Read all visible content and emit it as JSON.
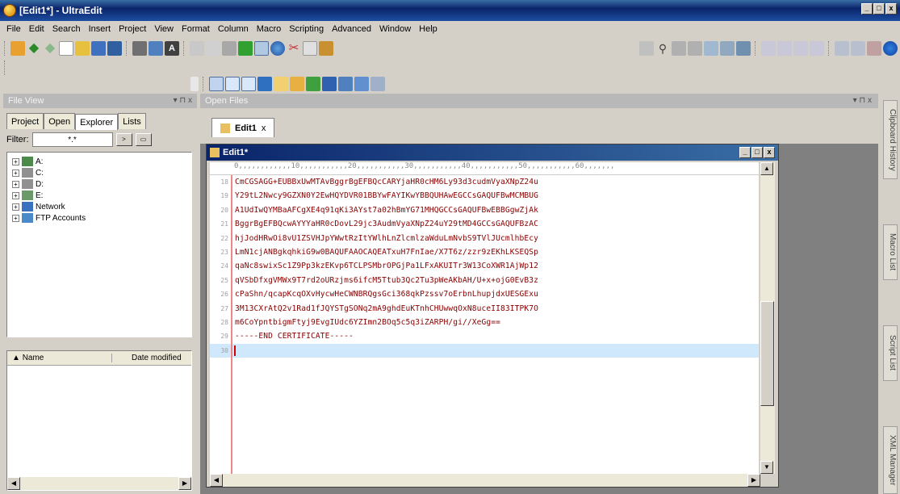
{
  "window": {
    "title": "[Edit1*] - UltraEdit",
    "min": "_",
    "max": "□",
    "close": "x"
  },
  "menu": [
    "File",
    "Edit",
    "Search",
    "Insert",
    "Project",
    "View",
    "Format",
    "Column",
    "Macro",
    "Scripting",
    "Advanced",
    "Window",
    "Help"
  ],
  "file_view": {
    "header": "File View",
    "tabs": [
      "Project",
      "Open",
      "Explorer",
      "Lists"
    ],
    "active_tab": "Explorer",
    "filter_label": "Filter:",
    "filter_value": "*.*",
    "tree": [
      "A:",
      "C:",
      "D:",
      "E:",
      "Network",
      "FTP Accounts"
    ],
    "columns": [
      "Name",
      "Date modified"
    ]
  },
  "open_files": {
    "header": "Open Files",
    "tab_label": "Edit1"
  },
  "editor": {
    "title": "Edit1*",
    "ruler": "0,,,,,,,,,,,,10,,,,,,,,,,,20,,,,,,,,,,,30,,,,,,,,,,,40,,,,,,,,,,,50,,,,,,,,,,,60,,,,,,,",
    "line_numbers": [
      "18",
      "19",
      "20",
      "21",
      "22",
      "23",
      "24",
      "25",
      "26",
      "27",
      "28",
      "29",
      "30"
    ],
    "lines": [
      "CmCGSAGG+EUBBxUwMTAvBggrBgEFBQcCARYjaHR0cHM6Ly93d3cudmVyaXNpZ24u",
      "Y29tL2Nwcy9GZXN0Y2EwHQYDVR01BBYwFAYIKwYBBQUHAwEGCCsGAQUFBwMCMBUG",
      "A1UdIwQYMBaAFCgXE4q91qKi3AYst7a02hBmYG71MHQGCCsGAQUFBwEBBGgwZjAk",
      "BggrBgEFBQcwAYYYaHR0cDovL29jc3AudmVyaXNpZ24uY29tMD4GCCsGAQUFBzAC",
      "hjJodHRwOi8vU1ZSVHJpYWwtRzItYWlhLnZlcmlzaWduLmNvbS9TVlJUcmlhbEcy",
      "LmN1cjANBgkqhkiG9w0BAQUFAAOCAQEATxuH7FnIae/X7T6z/zzr9zEKhLKSEQSp",
      "qaNc8swixSc1Z9Pp3kzEKvp6TCLPSMbrOPGjPa1LFxAKUITr3W13CoXWR1AjWp12",
      "qVSbDfxgVMWx9T7rd2oURzjms6ifcM5Ttub3Qc2Tu3pWeAKbAH/U+x+ojG0EvB3z",
      "cPaShn/qcapKcqOXvHycwHeCWNBRQgsGci368qkPzssv7oErbnLhupjdxUESGExu",
      "3M13CXrAtQ2v1Rad1fJQYSTgSONq2mA9ghdEuKTnhCHUwwqOxN8uceII83ITPK7O",
      "m6CoYpntbigmFtyj9EvgIUdc6YZImn2BOq5c5q3iZARPH/gi//XeGg==",
      "-----END CERTIFICATE-----",
      ""
    ]
  },
  "side_tabs": [
    "Clipboard History",
    "Macro List",
    "Script List",
    "XML Manager"
  ],
  "colors": {
    "titlebar": "#0a246a",
    "code_text": "#880000",
    "current_line": "#cfe8fb",
    "gutter_line": "#ee8888"
  }
}
